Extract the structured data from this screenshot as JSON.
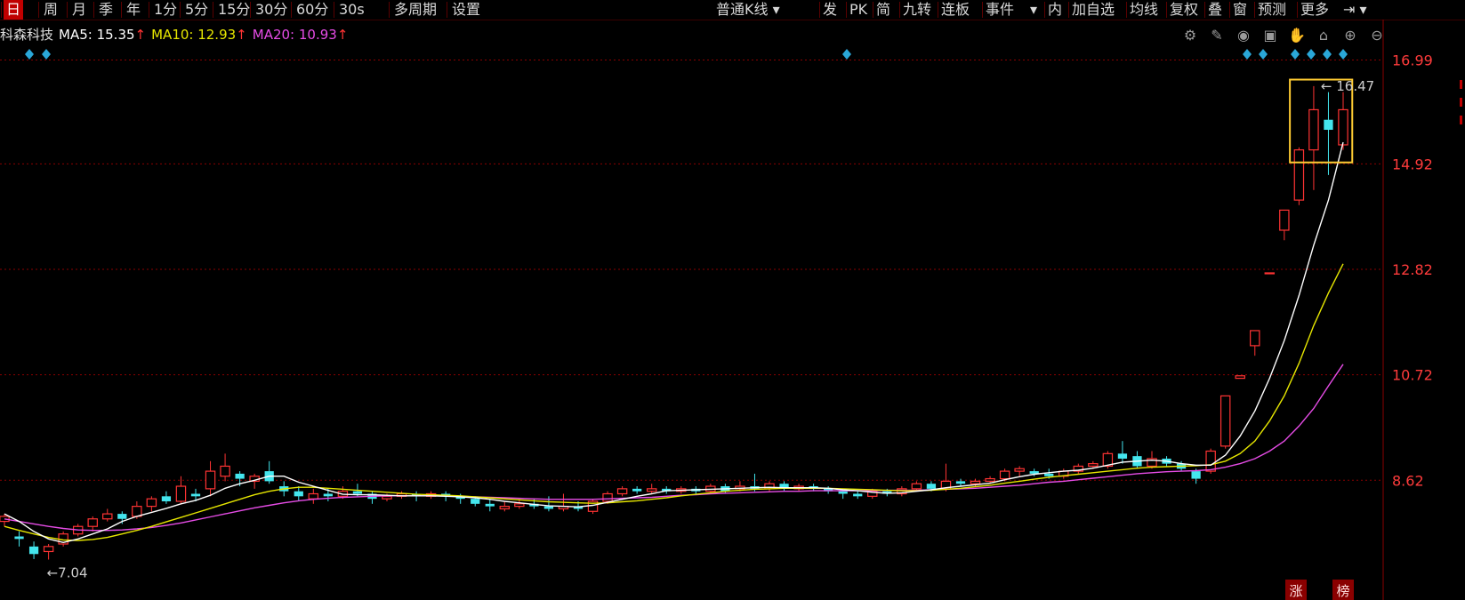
{
  "toolbar": {
    "periods": [
      "日",
      "周",
      "月",
      "季",
      "年",
      "1分",
      "5分",
      "15分",
      "30分",
      "60分",
      "30s",
      "多周期",
      "设置"
    ],
    "active_period": "日",
    "chart_type": "普通K线",
    "right_buttons": [
      "发",
      "PK",
      "简",
      "九转",
      "连板",
      "事件",
      "内",
      "加自选",
      "均线",
      "复权",
      "叠",
      "窗",
      "预测",
      "更多"
    ]
  },
  "legend": {
    "stock_name": "科森科技",
    "ma5_label": "MA5: 15.35",
    "ma10_label": "MA10: 12.93",
    "ma20_label": "MA20: 10.93",
    "arrow": "↑"
  },
  "chart_icons": [
    "gear-icon",
    "brush-icon",
    "eye-icon",
    "briefcase-icon",
    "hand-icon",
    "lock-icon",
    "zoom-in-icon",
    "zoom-out-icon"
  ],
  "colors": {
    "up": "#ff3333",
    "down": "#44e6ee",
    "ma5": "#ffffff",
    "ma10": "#e6e600",
    "ma20": "#e64ce6",
    "grid": "#8a0000",
    "axis_text": "#ff3b3b",
    "highlight": "#ffcc33",
    "badge": "#2aa7d8"
  },
  "badges": {
    "zhang": "涨",
    "bang": "榜"
  },
  "chart_data": {
    "type": "candlestick",
    "yaxis_ticks": [
      16.99,
      14.92,
      12.82,
      10.72,
      8.62
    ],
    "ylim": [
      6.5,
      17.3
    ],
    "max_label": "16.47",
    "min_label": "7.04",
    "candles": [
      [
        7.8,
        7.9,
        7.7,
        7.95
      ],
      [
        7.5,
        7.45,
        7.3,
        7.6
      ],
      [
        7.3,
        7.15,
        7.05,
        7.4
      ],
      [
        7.2,
        7.3,
        7.04,
        7.35
      ],
      [
        7.35,
        7.55,
        7.3,
        7.6
      ],
      [
        7.55,
        7.7,
        7.5,
        7.75
      ],
      [
        7.7,
        7.85,
        7.6,
        7.9
      ],
      [
        7.85,
        7.95,
        7.8,
        8.05
      ],
      [
        7.95,
        7.85,
        7.75,
        8.0
      ],
      [
        7.9,
        8.1,
        7.85,
        8.2
      ],
      [
        8.1,
        8.25,
        8.0,
        8.3
      ],
      [
        8.3,
        8.2,
        8.15,
        8.4
      ],
      [
        8.2,
        8.5,
        8.15,
        8.7
      ],
      [
        8.35,
        8.3,
        8.2,
        8.45
      ],
      [
        8.45,
        8.8,
        8.3,
        9.0
      ],
      [
        8.7,
        8.9,
        8.6,
        9.15
      ],
      [
        8.75,
        8.65,
        8.5,
        8.8
      ],
      [
        8.6,
        8.7,
        8.45,
        8.75
      ],
      [
        8.8,
        8.6,
        8.55,
        9.0
      ],
      [
        8.5,
        8.4,
        8.3,
        8.6
      ],
      [
        8.4,
        8.3,
        8.2,
        8.5
      ],
      [
        8.25,
        8.35,
        8.15,
        8.45
      ],
      [
        8.35,
        8.3,
        8.2,
        8.45
      ],
      [
        8.3,
        8.4,
        8.25,
        8.5
      ],
      [
        8.4,
        8.35,
        8.3,
        8.55
      ],
      [
        8.35,
        8.25,
        8.15,
        8.4
      ],
      [
        8.25,
        8.3,
        8.2,
        8.35
      ],
      [
        8.3,
        8.35,
        8.25,
        8.4
      ],
      [
        8.35,
        8.3,
        8.2,
        8.4
      ],
      [
        8.3,
        8.35,
        8.25,
        8.4
      ],
      [
        8.35,
        8.3,
        8.2,
        8.4
      ],
      [
        8.3,
        8.25,
        8.15,
        8.35
      ],
      [
        8.25,
        8.15,
        8.1,
        8.3
      ],
      [
        8.15,
        8.1,
        8.0,
        8.25
      ],
      [
        8.05,
        8.1,
        8.0,
        8.2
      ],
      [
        8.1,
        8.15,
        8.05,
        8.25
      ],
      [
        8.15,
        8.1,
        8.05,
        8.25
      ],
      [
        8.1,
        8.05,
        8.0,
        8.3
      ],
      [
        8.05,
        8.1,
        8.0,
        8.35
      ],
      [
        8.1,
        8.05,
        8.0,
        8.2
      ],
      [
        8.0,
        8.2,
        7.95,
        8.25
      ],
      [
        8.2,
        8.35,
        8.15,
        8.4
      ],
      [
        8.35,
        8.45,
        8.3,
        8.5
      ],
      [
        8.45,
        8.4,
        8.35,
        8.5
      ],
      [
        8.4,
        8.45,
        8.35,
        8.55
      ],
      [
        8.45,
        8.4,
        8.35,
        8.5
      ],
      [
        8.4,
        8.45,
        8.35,
        8.5
      ],
      [
        8.45,
        8.4,
        8.35,
        8.5
      ],
      [
        8.4,
        8.5,
        8.35,
        8.55
      ],
      [
        8.5,
        8.4,
        8.35,
        8.55
      ],
      [
        8.45,
        8.5,
        8.4,
        8.6
      ],
      [
        8.5,
        8.45,
        8.4,
        8.75
      ],
      [
        8.45,
        8.55,
        8.4,
        8.6
      ],
      [
        8.55,
        8.45,
        8.4,
        8.6
      ],
      [
        8.45,
        8.5,
        8.4,
        8.55
      ],
      [
        8.5,
        8.45,
        8.4,
        8.55
      ],
      [
        8.45,
        8.4,
        8.35,
        8.5
      ],
      [
        8.4,
        8.35,
        8.25,
        8.45
      ],
      [
        8.35,
        8.3,
        8.25,
        8.4
      ],
      [
        8.3,
        8.4,
        8.25,
        8.45
      ],
      [
        8.4,
        8.35,
        8.3,
        8.45
      ],
      [
        8.35,
        8.45,
        8.3,
        8.5
      ],
      [
        8.45,
        8.55,
        8.4,
        8.6
      ],
      [
        8.55,
        8.45,
        8.4,
        8.6
      ],
      [
        8.45,
        8.6,
        8.4,
        8.95
      ],
      [
        8.6,
        8.55,
        8.5,
        8.65
      ],
      [
        8.55,
        8.6,
        8.5,
        8.65
      ],
      [
        8.6,
        8.65,
        8.55,
        8.7
      ],
      [
        8.65,
        8.8,
        8.6,
        8.85
      ],
      [
        8.8,
        8.85,
        8.7,
        8.9
      ],
      [
        8.8,
        8.75,
        8.7,
        8.85
      ],
      [
        8.75,
        8.7,
        8.65,
        8.85
      ],
      [
        8.7,
        8.8,
        8.65,
        8.85
      ],
      [
        8.8,
        8.9,
        8.75,
        8.95
      ],
      [
        8.9,
        8.95,
        8.85,
        9.0
      ],
      [
        8.9,
        9.15,
        8.85,
        9.2
      ],
      [
        9.15,
        9.05,
        8.95,
        9.4
      ],
      [
        9.1,
        8.9,
        8.85,
        9.2
      ],
      [
        8.9,
        9.05,
        8.85,
        9.2
      ],
      [
        9.05,
        8.95,
        8.9,
        9.1
      ],
      [
        8.95,
        8.85,
        8.8,
        9.0
      ],
      [
        8.8,
        8.65,
        8.55,
        8.85
      ],
      [
        8.8,
        9.2,
        8.75,
        9.25
      ],
      [
        9.3,
        10.3,
        9.25,
        10.3
      ],
      [
        10.65,
        10.7,
        10.65,
        10.7
      ],
      [
        11.3,
        11.6,
        11.1,
        11.6
      ],
      [
        12.75,
        12.75,
        12.75,
        12.75
      ],
      [
        13.6,
        14.0,
        13.4,
        14.0
      ],
      [
        14.2,
        15.2,
        14.1,
        15.25
      ],
      [
        15.2,
        16.0,
        14.4,
        16.47
      ],
      [
        15.8,
        15.6,
        14.7,
        16.35
      ],
      [
        15.3,
        16.0,
        15.2,
        16.35
      ]
    ],
    "ma5": [
      7.95,
      7.8,
      7.6,
      7.45,
      7.38,
      7.45,
      7.55,
      7.65,
      7.8,
      7.9,
      7.98,
      8.06,
      8.15,
      8.22,
      8.32,
      8.46,
      8.55,
      8.62,
      8.7,
      8.7,
      8.58,
      8.5,
      8.42,
      8.34,
      8.33,
      8.33,
      8.32,
      8.31,
      8.31,
      8.31,
      8.3,
      8.29,
      8.27,
      8.24,
      8.2,
      8.17,
      8.14,
      8.11,
      8.1,
      8.09,
      8.12,
      8.18,
      8.24,
      8.3,
      8.35,
      8.41,
      8.42,
      8.43,
      8.44,
      8.45,
      8.46,
      8.47,
      8.48,
      8.47,
      8.47,
      8.47,
      8.46,
      8.43,
      8.41,
      8.38,
      8.36,
      8.37,
      8.4,
      8.43,
      8.47,
      8.5,
      8.53,
      8.56,
      8.63,
      8.69,
      8.74,
      8.77,
      8.8,
      8.82,
      8.86,
      8.92,
      8.98,
      9.0,
      9.02,
      9.0,
      8.95,
      8.92,
      8.92,
      9.12,
      9.5,
      10.0,
      10.65,
      11.4,
      12.3,
      13.3,
      14.2,
      15.35
    ],
    "ma10": [
      7.7,
      7.62,
      7.55,
      7.48,
      7.43,
      7.42,
      7.44,
      7.48,
      7.55,
      7.62,
      7.7,
      7.79,
      7.88,
      7.97,
      8.06,
      8.15,
      8.24,
      8.33,
      8.4,
      8.45,
      8.48,
      8.48,
      8.46,
      8.44,
      8.42,
      8.4,
      8.38,
      8.36,
      8.34,
      8.33,
      8.32,
      8.31,
      8.29,
      8.27,
      8.25,
      8.23,
      8.21,
      8.19,
      8.18,
      8.17,
      8.16,
      8.17,
      8.19,
      8.21,
      8.24,
      8.27,
      8.31,
      8.34,
      8.37,
      8.4,
      8.42,
      8.44,
      8.45,
      8.46,
      8.46,
      8.46,
      8.46,
      8.45,
      8.44,
      8.43,
      8.42,
      8.41,
      8.41,
      8.42,
      8.44,
      8.46,
      8.49,
      8.52,
      8.56,
      8.6,
      8.64,
      8.68,
      8.71,
      8.74,
      8.77,
      8.8,
      8.83,
      8.86,
      8.88,
      8.89,
      8.9,
      8.91,
      8.93,
      9.0,
      9.15,
      9.4,
      9.8,
      10.3,
      10.95,
      11.7,
      12.35,
      12.93
    ],
    "ma20": [
      7.85,
      7.8,
      7.75,
      7.7,
      7.66,
      7.63,
      7.62,
      7.62,
      7.63,
      7.65,
      7.68,
      7.72,
      7.77,
      7.83,
      7.89,
      7.95,
      8.01,
      8.07,
      8.12,
      8.17,
      8.21,
      8.24,
      8.26,
      8.28,
      8.29,
      8.3,
      8.31,
      8.31,
      8.31,
      8.31,
      8.31,
      8.3,
      8.29,
      8.28,
      8.27,
      8.26,
      8.25,
      8.24,
      8.24,
      8.24,
      8.24,
      8.25,
      8.26,
      8.27,
      8.28,
      8.3,
      8.32,
      8.33,
      8.35,
      8.36,
      8.37,
      8.38,
      8.39,
      8.4,
      8.4,
      8.41,
      8.41,
      8.41,
      8.41,
      8.41,
      8.42,
      8.42,
      8.42,
      8.43,
      8.44,
      8.45,
      8.46,
      8.48,
      8.5,
      8.52,
      8.55,
      8.58,
      8.6,
      8.63,
      8.66,
      8.69,
      8.72,
      8.75,
      8.77,
      8.79,
      8.8,
      8.81,
      8.83,
      8.88,
      8.95,
      9.05,
      9.2,
      9.4,
      9.7,
      10.05,
      10.5,
      10.93
    ]
  }
}
